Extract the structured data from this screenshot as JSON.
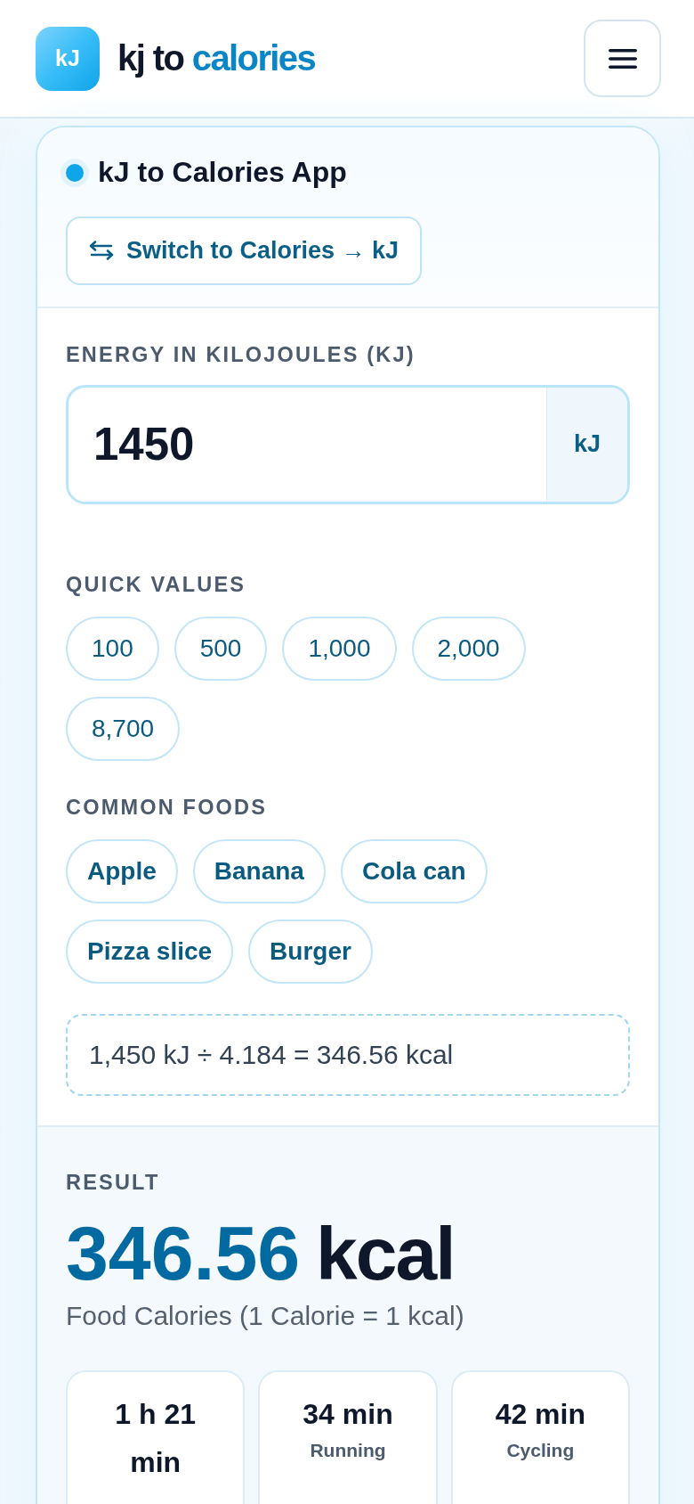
{
  "header": {
    "logo": "kJ",
    "brand": {
      "lead": "kj to",
      "accent": "calories"
    }
  },
  "card": {
    "title": "kJ to Calories App",
    "switch_button": "Switch to Calories → kJ"
  },
  "energy_input": {
    "label": "ENERGY IN KILOJOULES (KJ)",
    "value": "1450",
    "unit": "kJ"
  },
  "quick_values": {
    "label": "QUICK VALUES",
    "items": [
      "100",
      "500",
      "1,000",
      "2,000",
      "8,700"
    ]
  },
  "common_foods": {
    "label": "COMMON FOODS",
    "items": [
      "Apple",
      "Banana",
      "Cola can",
      "Pizza slice",
      "Burger"
    ]
  },
  "formula": "1,450 kJ ÷ 4.184 = 346.56 kcal",
  "result": {
    "label": "RESULT",
    "value": "346.56",
    "unit": "kcal",
    "note": "Food Calories (1 Calorie = 1 kcal)",
    "activities": [
      {
        "time": "1 h 21 min"
      },
      {
        "time": "34 min",
        "activity": "Running"
      },
      {
        "time": "42 min",
        "activity": "Cycling"
      }
    ]
  }
}
